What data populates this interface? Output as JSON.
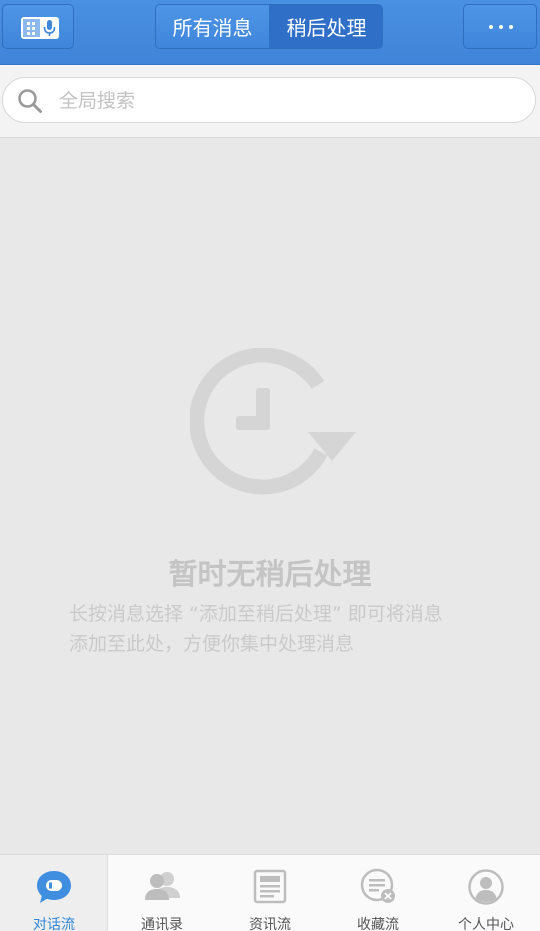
{
  "header": {
    "tabs": [
      {
        "label": "所有消息",
        "selected": false
      },
      {
        "label": "稍后处理",
        "selected": true
      }
    ],
    "left_icon": "contacts-voice-icon",
    "right_icon": "more-dots-icon"
  },
  "search": {
    "placeholder": "全局搜索",
    "value": "",
    "icon": "search-icon"
  },
  "empty_state": {
    "icon": "clock-later-icon",
    "title": "暂时无稍后处理",
    "desc_line1": "长按消息选择 “添加至稍后处理” 即可将消息",
    "desc_line2": "添加至此处，方便你集中处理消息"
  },
  "bottom_nav": {
    "items": [
      {
        "label": "对话流",
        "icon": "chat-bubble-icon",
        "active": true
      },
      {
        "label": "通讯录",
        "icon": "contacts-icon",
        "active": false
      },
      {
        "label": "资讯流",
        "icon": "news-icon",
        "active": false
      },
      {
        "label": "收藏流",
        "icon": "favorites-icon",
        "active": false
      },
      {
        "label": "个人中心",
        "icon": "profile-icon",
        "active": false
      }
    ]
  },
  "colors": {
    "header_blue": "#4a90e2",
    "active_blue": "#2f86d8",
    "muted_gray": "#c4c4c4"
  }
}
